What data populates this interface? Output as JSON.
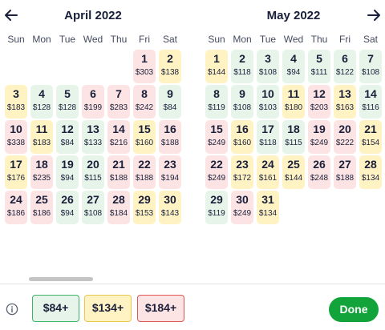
{
  "colors": {
    "green": "#e6f4ea",
    "yellow": "#fff3c4",
    "red": "#fde4e4",
    "done_button": "#12a43a"
  },
  "icons": {
    "prev": "arrow-left-icon",
    "next": "arrow-right-icon",
    "info": "info-icon"
  },
  "weekdays": [
    "Sun",
    "Mon",
    "Tue",
    "Wed",
    "Thu",
    "Fri",
    "Sat"
  ],
  "months": [
    {
      "title": "April 2022",
      "first_weekday": 5,
      "days": [
        {
          "d": "1",
          "p": "$303",
          "c": "r"
        },
        {
          "d": "2",
          "p": "$138",
          "c": "y"
        },
        {
          "d": "3",
          "p": "$183",
          "c": "y"
        },
        {
          "d": "4",
          "p": "$128",
          "c": "g"
        },
        {
          "d": "5",
          "p": "$128",
          "c": "g"
        },
        {
          "d": "6",
          "p": "$199",
          "c": "r"
        },
        {
          "d": "7",
          "p": "$283",
          "c": "r"
        },
        {
          "d": "8",
          "p": "$242",
          "c": "r"
        },
        {
          "d": "9",
          "p": "$84",
          "c": "g"
        },
        {
          "d": "10",
          "p": "$338",
          "c": "r"
        },
        {
          "d": "11",
          "p": "$183",
          "c": "y"
        },
        {
          "d": "12",
          "p": "$84",
          "c": "g"
        },
        {
          "d": "13",
          "p": "$133",
          "c": "g"
        },
        {
          "d": "14",
          "p": "$216",
          "c": "r"
        },
        {
          "d": "15",
          "p": "$160",
          "c": "y"
        },
        {
          "d": "16",
          "p": "$188",
          "c": "r"
        },
        {
          "d": "17",
          "p": "$176",
          "c": "y"
        },
        {
          "d": "18",
          "p": "$235",
          "c": "r"
        },
        {
          "d": "19",
          "p": "$94",
          "c": "g"
        },
        {
          "d": "20",
          "p": "$115",
          "c": "g"
        },
        {
          "d": "21",
          "p": "$188",
          "c": "r"
        },
        {
          "d": "22",
          "p": "$188",
          "c": "r"
        },
        {
          "d": "23",
          "p": "$194",
          "c": "r"
        },
        {
          "d": "24",
          "p": "$186",
          "c": "r"
        },
        {
          "d": "25",
          "p": "$186",
          "c": "r"
        },
        {
          "d": "26",
          "p": "$94",
          "c": "g"
        },
        {
          "d": "27",
          "p": "$108",
          "c": "g"
        },
        {
          "d": "28",
          "p": "$184",
          "c": "r"
        },
        {
          "d": "29",
          "p": "$153",
          "c": "y"
        },
        {
          "d": "30",
          "p": "$143",
          "c": "y"
        }
      ]
    },
    {
      "title": "May 2022",
      "first_weekday": 0,
      "days": [
        {
          "d": "1",
          "p": "$144",
          "c": "y"
        },
        {
          "d": "2",
          "p": "$118",
          "c": "g"
        },
        {
          "d": "3",
          "p": "$108",
          "c": "g"
        },
        {
          "d": "4",
          "p": "$94",
          "c": "g"
        },
        {
          "d": "5",
          "p": "$111",
          "c": "g"
        },
        {
          "d": "6",
          "p": "$122",
          "c": "g"
        },
        {
          "d": "7",
          "p": "$108",
          "c": "g"
        },
        {
          "d": "8",
          "p": "$119",
          "c": "g"
        },
        {
          "d": "9",
          "p": "$108",
          "c": "g"
        },
        {
          "d": "10",
          "p": "$103",
          "c": "g"
        },
        {
          "d": "11",
          "p": "$180",
          "c": "y"
        },
        {
          "d": "12",
          "p": "$203",
          "c": "r"
        },
        {
          "d": "13",
          "p": "$163",
          "c": "y"
        },
        {
          "d": "14",
          "p": "$116",
          "c": "g"
        },
        {
          "d": "15",
          "p": "$249",
          "c": "r"
        },
        {
          "d": "16",
          "p": "$160",
          "c": "y"
        },
        {
          "d": "17",
          "p": "$118",
          "c": "g"
        },
        {
          "d": "18",
          "p": "$115",
          "c": "g"
        },
        {
          "d": "19",
          "p": "$249",
          "c": "r"
        },
        {
          "d": "20",
          "p": "$222",
          "c": "r"
        },
        {
          "d": "21",
          "p": "$154",
          "c": "y"
        },
        {
          "d": "22",
          "p": "$249",
          "c": "r"
        },
        {
          "d": "23",
          "p": "$172",
          "c": "y"
        },
        {
          "d": "24",
          "p": "$161",
          "c": "y"
        },
        {
          "d": "25",
          "p": "$144",
          "c": "y"
        },
        {
          "d": "26",
          "p": "$248",
          "c": "r"
        },
        {
          "d": "27",
          "p": "$188",
          "c": "r"
        },
        {
          "d": "28",
          "p": "$134",
          "c": "y"
        },
        {
          "d": "29",
          "p": "$119",
          "c": "g"
        },
        {
          "d": "30",
          "p": "$249",
          "c": "r"
        },
        {
          "d": "31",
          "p": "$134",
          "c": "y"
        }
      ]
    }
  ],
  "legend": [
    {
      "label": "$84+",
      "color": "green"
    },
    {
      "label": "$134+",
      "color": "yellow"
    },
    {
      "label": "$184+",
      "color": "red"
    }
  ],
  "done_label": "Done"
}
